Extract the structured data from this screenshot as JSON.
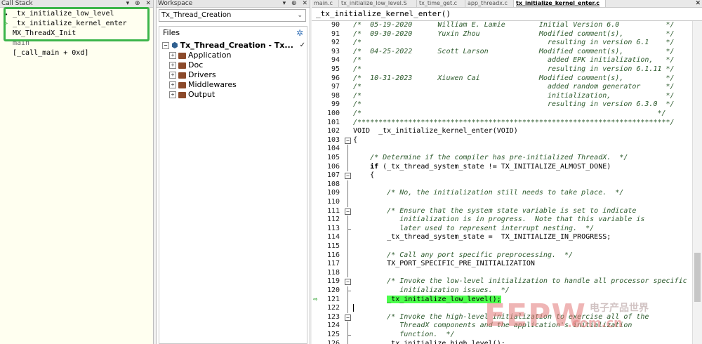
{
  "callstack": {
    "title": "Call Stack",
    "controls": [
      "▾",
      "⊕",
      "✕"
    ],
    "frames": [
      "_tx_initialize_low_level",
      "_tx_initialize_kernel_enter",
      "MX_ThreadX_Init",
      "main",
      "[_call_main + 0xd]"
    ],
    "highlight_color": "#3cb54a"
  },
  "workspace": {
    "title": "Workspace",
    "controls": [
      "▾",
      "⊕",
      "✕"
    ],
    "config": "Tx_Thread_Creation",
    "files_label": "Files",
    "project": "Tx_Thread_Creation - Tx...",
    "folders": [
      "Application",
      "Doc",
      "Drivers",
      "Middlewares",
      "Output"
    ]
  },
  "editor": {
    "tabs": [
      "main.c",
      "tx_initialize_low_level.S",
      "tx_time_get.c",
      "app_threadx.c",
      "tx_initialize_kernel_enter.c"
    ],
    "active_tab": "tx_initialize_kernel_enter.c",
    "function_header": "_tx_initialize_kernel_enter()",
    "current_line": 121,
    "highlight_color": "#4cff4c",
    "lines": [
      {
        "n": "90",
        "t": "/*  05-19-2020      William E. Lamie        Initial Version 6.0           */",
        "c": "cmt"
      },
      {
        "n": "91",
        "t": "/*  09-30-2020      Yuxin Zhou              Modified comment(s),          */",
        "c": "cmt"
      },
      {
        "n": "92",
        "t": "/*                                            resulting in version 6.1    */",
        "c": "cmt"
      },
      {
        "n": "93",
        "t": "/*  04-25-2022      Scott Larson            Modified comment(s),          */",
        "c": "cmt"
      },
      {
        "n": "94",
        "t": "/*                                            added EPK initialization,   */",
        "c": "cmt"
      },
      {
        "n": "95",
        "t": "/*                                            resulting in version 6.1.11 */",
        "c": "cmt"
      },
      {
        "n": "96",
        "t": "/*  10-31-2023      Xiuwen Cai              Modified comment(s),          */",
        "c": "cmt"
      },
      {
        "n": "97",
        "t": "/*                                            added random generator      */",
        "c": "cmt"
      },
      {
        "n": "98",
        "t": "/*                                            initialization,             */",
        "c": "cmt"
      },
      {
        "n": "99",
        "t": "/*                                            resulting in version 6.3.0  */",
        "c": "cmt"
      },
      {
        "n": "100",
        "t": "/*                                                                      */",
        "c": "cmt"
      },
      {
        "n": "101",
        "t": "/**************************************************************************/",
        "c": "cmt"
      },
      {
        "n": "102",
        "t": "VOID  _tx_initialize_kernel_enter(VOID)",
        "c": ""
      },
      {
        "n": "103",
        "t": "{",
        "c": "",
        "fold": "−"
      },
      {
        "n": "104",
        "t": "",
        "c": ""
      },
      {
        "n": "105",
        "t": "    /* Determine if the compiler has pre-initialized ThreadX.  */",
        "c": "cmt"
      },
      {
        "n": "106",
        "t": "    if (_tx_thread_system_state != TX_INITIALIZE_ALMOST_DONE)",
        "c": "if"
      },
      {
        "n": "107",
        "t": "    {",
        "c": "",
        "fold": "−"
      },
      {
        "n": "108",
        "t": "",
        "c": ""
      },
      {
        "n": "109",
        "t": "        /* No, the initialization still needs to take place.  */",
        "c": "cmt"
      },
      {
        "n": "110",
        "t": "",
        "c": ""
      },
      {
        "n": "111",
        "t": "        /* Ensure that the system state variable is set to indicate",
        "c": "cmt",
        "fold": "−"
      },
      {
        "n": "112",
        "t": "           initialization is in progress.  Note that this variable is",
        "c": "cmt"
      },
      {
        "n": "113",
        "t": "           later used to represent interrupt nesting.  */",
        "c": "cmt",
        "tick": true
      },
      {
        "n": "114",
        "t": "        _tx_thread_system_state =  TX_INITIALIZE_IN_PROGRESS;",
        "c": ""
      },
      {
        "n": "115",
        "t": "",
        "c": ""
      },
      {
        "n": "116",
        "t": "        /* Call any port specific preprocessing.  */",
        "c": "cmt"
      },
      {
        "n": "117",
        "t": "        TX_PORT_SPECIFIC_PRE_INITIALIZATION",
        "c": ""
      },
      {
        "n": "118",
        "t": "",
        "c": ""
      },
      {
        "n": "119",
        "t": "        /* Invoke the low-level initialization to handle all processor specific",
        "c": "cmt",
        "fold": "−"
      },
      {
        "n": "120",
        "t": "           initialization issues.  */",
        "c": "cmt",
        "tick": true
      },
      {
        "n": "121",
        "t": "        _tx_initialize_low_level();",
        "c": "hl",
        "pc": true
      },
      {
        "n": "122",
        "t": "",
        "c": "caret"
      },
      {
        "n": "123",
        "t": "        /* Invoke the high-level initialization to exercise all of the",
        "c": "cmt",
        "fold": "−"
      },
      {
        "n": "124",
        "t": "           ThreadX components and the application's initialization",
        "c": "cmt"
      },
      {
        "n": "125",
        "t": "           function.  */",
        "c": "cmt",
        "tick": true
      },
      {
        "n": "126",
        "t": "        _tx_initialize_high_level();",
        "c": ""
      }
    ]
  },
  "watermark": {
    "brand": "EEPW",
    "domain": ".com.cn",
    "chinese": "电子产品世界"
  }
}
